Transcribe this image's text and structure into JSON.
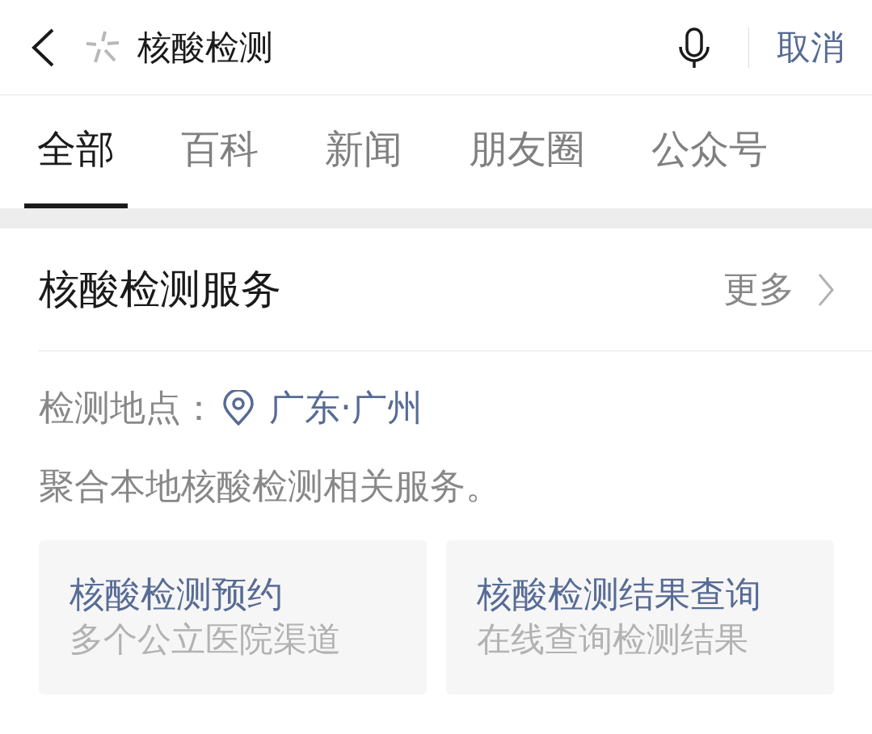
{
  "search_bar": {
    "query": "核酸检测",
    "cancel": "取消"
  },
  "tabs": [
    {
      "label": "全部",
      "selected": true
    },
    {
      "label": "百科",
      "selected": false
    },
    {
      "label": "新闻",
      "selected": false
    },
    {
      "label": "朋友圈",
      "selected": false
    },
    {
      "label": "公众号",
      "selected": false
    }
  ],
  "service_section": {
    "title": "核酸检测服务",
    "more": "更多",
    "location_label": "检测地点：",
    "location": "广东·广州",
    "description": "聚合本地核酸检测相关服务。",
    "actions": [
      {
        "title": "核酸检测预约",
        "subtitle": "多个公立医院渠道"
      },
      {
        "title": "核酸检测结果查询",
        "subtitle": "在线查询检测结果"
      }
    ]
  }
}
